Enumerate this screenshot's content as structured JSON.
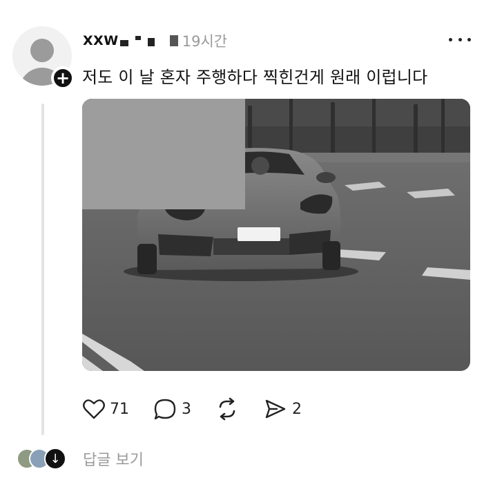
{
  "post": {
    "username": "XXW",
    "timestamp": "19시간",
    "text": "저도 이 날 혼자 주행하다 찍힌건게 원래 이럽니다",
    "follow_symbol": "+",
    "more_icon": "more-horizontal-icon"
  },
  "actions": {
    "like_count": "71",
    "comment_count": "3",
    "share_count": "2",
    "like_icon": "heart-icon",
    "comment_icon": "comment-bubble-icon",
    "repost_icon": "repost-icon",
    "share_icon": "send-icon"
  },
  "replies": {
    "label": "답글 보기",
    "expand_symbol": "↓"
  },
  "colors": {
    "text": "#111111",
    "muted": "#9a9a9a",
    "thread_line": "#e3e3e3"
  }
}
